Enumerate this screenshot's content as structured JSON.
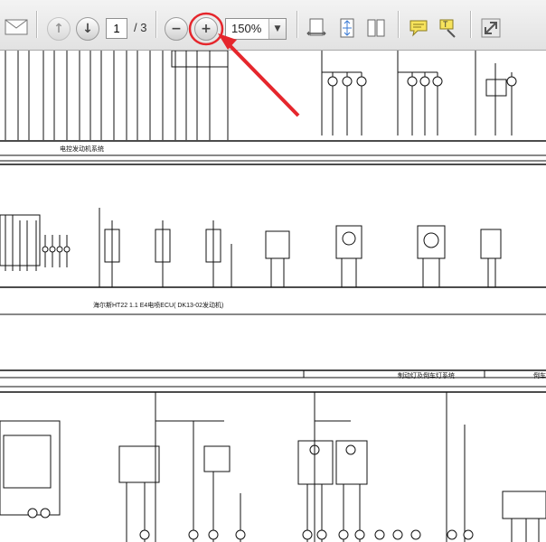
{
  "toolbar": {
    "current_page": "1",
    "page_total": "/ 3",
    "zoom_value": "150%"
  },
  "icons": {
    "email": "envelope-icon",
    "prev_page": "arrow-up-icon",
    "next_page": "arrow-down-icon",
    "zoom_out": "minus-icon",
    "zoom_in": "plus-icon",
    "zoom_dropdown": "chevron-down-icon",
    "fit_width": "fit-width-icon",
    "fit_page": "fit-page-icon",
    "two_page": "two-page-icon",
    "comment": "speech-bubble-icon",
    "highlight": "highlight-text-icon",
    "expand": "expand-arrows-icon"
  },
  "annotation": {
    "color": "#e5262c"
  },
  "document": {
    "captions": [
      "电控发动机系统",
      "海尔斯HT22 1.1 E4电喷ECU( DK13-02发动机)",
      "制动灯及倒车灯系统",
      "倒车警"
    ]
  }
}
